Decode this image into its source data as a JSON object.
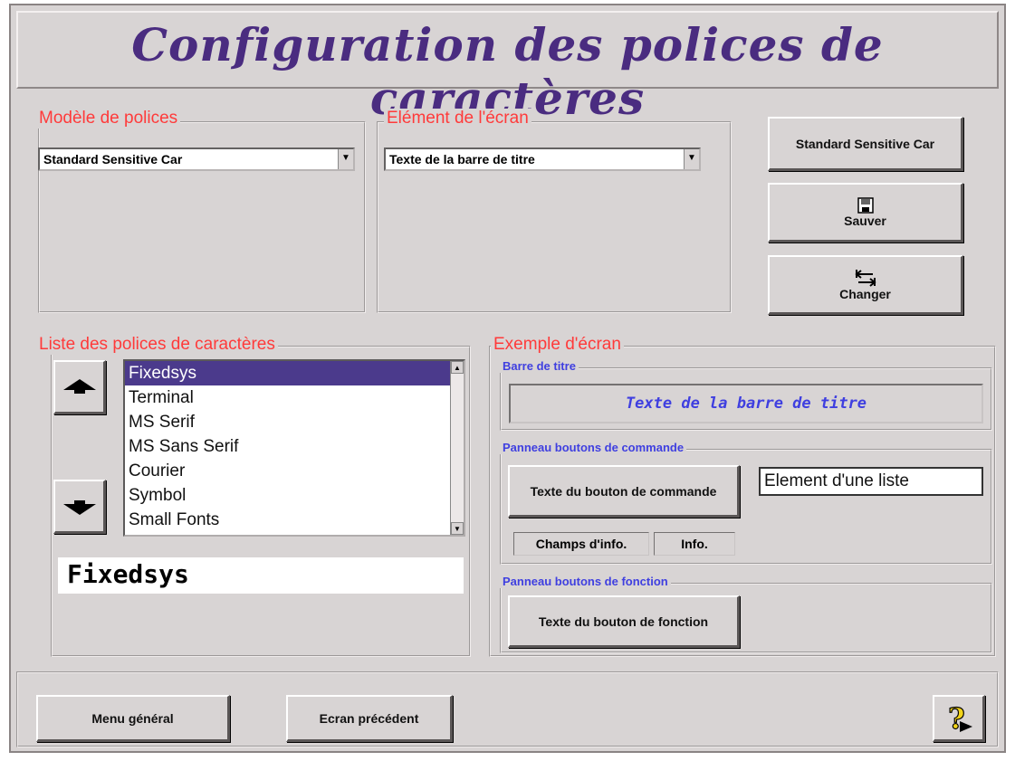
{
  "title": "Configuration des polices de caractères",
  "font_model": {
    "label": "Modèle de polices",
    "selected": "Standard Sensitive Car"
  },
  "screen_element": {
    "label": "Elément de l'écran",
    "selected": "Texte de la barre de titre"
  },
  "right_buttons": {
    "standard": "Standard Sensitive Car",
    "save": "Sauver",
    "change": "Changer",
    "save_icon": "floppy-disk-icon",
    "change_icon": "swap-arrows-icon"
  },
  "font_list": {
    "label": "Liste des polices de caractères",
    "items": [
      "Fixedsys",
      "Terminal",
      "MS Serif",
      "MS Sans Serif",
      "Courier",
      "Symbol",
      "Small Fonts"
    ],
    "selected_index": 0,
    "preview_text": "Fixedsys",
    "up_icon": "arrow-up-icon",
    "down_icon": "arrow-down-icon"
  },
  "sample": {
    "label": "Exemple d'écran",
    "title_bar_group": "Barre de titre",
    "title_bar_text": "Texte de la barre de titre",
    "command_group": "Panneau boutons de commande",
    "command_button": "Texte du bouton de commande",
    "list_element": "Element d'une liste",
    "info_field_label": "Champs d'info.",
    "info_field_value": "Info.",
    "function_group": "Panneau boutons de fonction",
    "function_button": "Texte du bouton de fonction"
  },
  "footer": {
    "menu_button": "Menu général",
    "back_button": "Ecran précédent",
    "help_icon": "help-question-icon"
  },
  "colors": {
    "title": "#4a2c80",
    "group_label": "#ff3a3a",
    "sub_label": "#3f3fe0",
    "selection": "#4b3a8c",
    "window_bg": "#d8d4d4"
  }
}
